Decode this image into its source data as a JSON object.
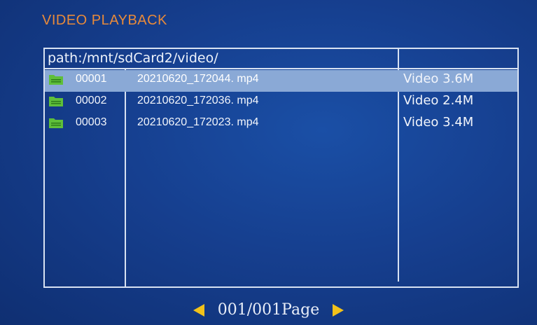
{
  "header": {
    "title": "VIDEO PLAYBACK"
  },
  "browser": {
    "path": "path:/mnt/sdCard2/video/",
    "files": [
      {
        "index": "00001",
        "name": "20210620_172044. mp4",
        "info": "Video 3.6M",
        "selected": true
      },
      {
        "index": "00002",
        "name": "20210620_172036. mp4",
        "info": "Video 2.4M",
        "selected": false
      },
      {
        "index": "00003",
        "name": "20210620_172023. mp4",
        "info": "Video 3.4M",
        "selected": false
      }
    ]
  },
  "pager": {
    "text": "001/001Page"
  },
  "colors": {
    "title": "#e88a3a",
    "folder": "#5fbf3a",
    "arrow": "#f2c21a",
    "selection": "#8aa9d6"
  },
  "icons": {
    "file": "folder-icon",
    "prev": "arrow-left-icon",
    "next": "arrow-right-icon"
  }
}
